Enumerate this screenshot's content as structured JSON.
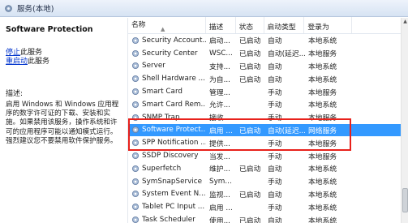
{
  "window": {
    "title": "服务(本地)",
    "icon": "gear-icon"
  },
  "left_pane": {
    "service_title": "Software Protection",
    "stop_link": "停止",
    "stop_suffix": "此服务",
    "restart_link": "重启动",
    "restart_suffix": "此服务",
    "desc_label": "描述:",
    "desc_text": "启用 Windows 和 Windows 应用程序的数字许可证的下载、安装和实施。如果禁用该服务，操作系统和许可的应用程序可能以通知模式运行。强烈建议您不要禁用软件保护服务。"
  },
  "table": {
    "columns": [
      "名称",
      "描述",
      "状态",
      "启动类型",
      "登录为"
    ],
    "rows": [
      {
        "name": "Security Account...",
        "desc": "启动...",
        "status": "已启动",
        "startup": "自动",
        "logon": "本地系统"
      },
      {
        "name": "Security Center",
        "desc": "WSC...",
        "status": "已启动",
        "startup": "自动(延迟...",
        "logon": "本地服务"
      },
      {
        "name": "Server",
        "desc": "支持...",
        "status": "已启动",
        "startup": "自动",
        "logon": "本地系统"
      },
      {
        "name": "Shell Hardware ...",
        "desc": "为自...",
        "status": "已启动",
        "startup": "自动",
        "logon": "本地系统"
      },
      {
        "name": "Smart Card",
        "desc": "管理...",
        "status": "",
        "startup": "手动",
        "logon": "本地服务"
      },
      {
        "name": "Smart Card Rem...",
        "desc": "允许...",
        "status": "",
        "startup": "手动",
        "logon": "本地系统"
      },
      {
        "name": "SNMP Trap",
        "desc": "接收...",
        "status": "",
        "startup": "手动",
        "logon": "本地服务"
      },
      {
        "name": "Software Protect...",
        "desc": "启用 ...",
        "status": "已启动",
        "startup": "自动(延迟...",
        "logon": "网络服务",
        "selected": true
      },
      {
        "name": "SPP Notification ...",
        "desc": "提供...",
        "status": "",
        "startup": "手动",
        "logon": "本地服务"
      },
      {
        "name": "SSDP Discovery",
        "desc": "当发...",
        "status": "",
        "startup": "手动",
        "logon": "本地服务"
      },
      {
        "name": "Superfetch",
        "desc": "维护...",
        "status": "已启动",
        "startup": "自动",
        "logon": "本地系统"
      },
      {
        "name": "SymSnapService",
        "desc": "Sym...",
        "status": "",
        "startup": "手动",
        "logon": "本地系统"
      },
      {
        "name": "System Event N...",
        "desc": "监视...",
        "status": "已启动",
        "startup": "自动",
        "logon": "本地系统"
      },
      {
        "name": "Tablet PC Input ...",
        "desc": "启用 ...",
        "status": "",
        "startup": "手动",
        "logon": "本地系统"
      },
      {
        "name": "Task Scheduler",
        "desc": "使用...",
        "status": "已启动",
        "startup": "自动",
        "logon": "本地系统"
      }
    ]
  },
  "colors": {
    "selection": "#3399ff",
    "highlight_box": "#e8211b",
    "link": "#0033cc"
  }
}
